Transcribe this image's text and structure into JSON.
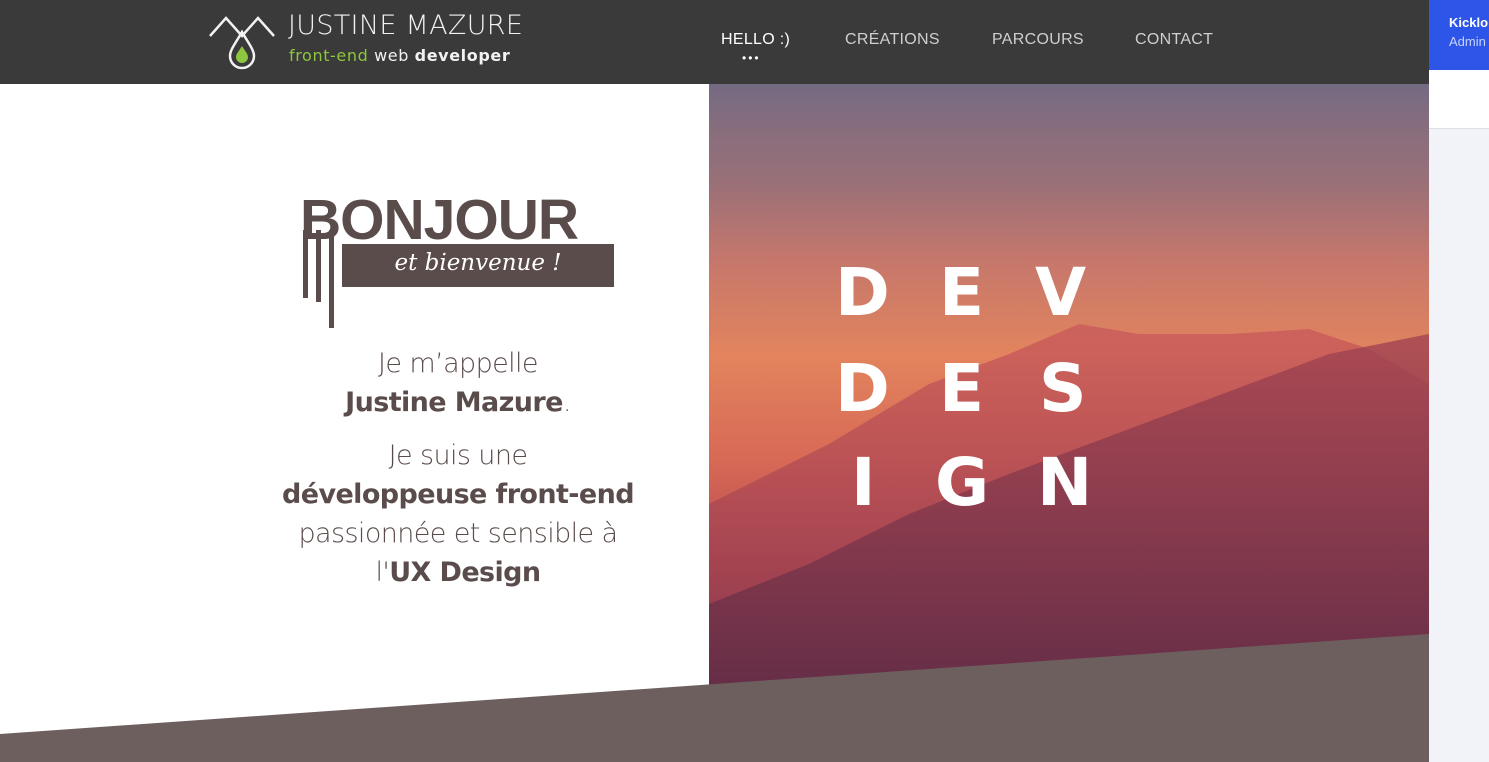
{
  "header": {
    "logo_name": "JUSTINE MAZURE",
    "logo_tag_green": "front-end",
    "logo_tag_mid": "web",
    "logo_tag_bold": "developer",
    "nav": [
      {
        "label": "HELLO :)",
        "active": true
      },
      {
        "label": "CRÉATIONS",
        "active": false
      },
      {
        "label": "PARCOURS",
        "active": false
      },
      {
        "label": "CONTACT",
        "active": false
      }
    ],
    "active_dots": "•••"
  },
  "hero": {
    "title": "BONJOUR",
    "subtitle": "et bienvenue !",
    "intro_line1": "Je m’appelle",
    "intro_name": "Justine Mazure",
    "intro_name_end": ".",
    "intro_line3": "Je suis une",
    "intro_role": "développeuse front-end",
    "intro_line5": "passionnée et sensible à",
    "intro_line6_pre": "l'",
    "intro_line6_bold": "UX Design",
    "image_words": {
      "row1": [
        "D",
        "E",
        "V"
      ],
      "row2": [
        "D",
        "E",
        "S"
      ],
      "row3": [
        "I",
        "G",
        "N"
      ]
    }
  },
  "side_panel": {
    "title": "Kicklo",
    "subtitle": "Admin"
  },
  "colors": {
    "header_bg": "#3a3a3a",
    "accent_green": "#8dc63f",
    "text_brown": "#5a4c4b",
    "band": "#6e5f5f",
    "side_blue": "#2d55e8"
  }
}
